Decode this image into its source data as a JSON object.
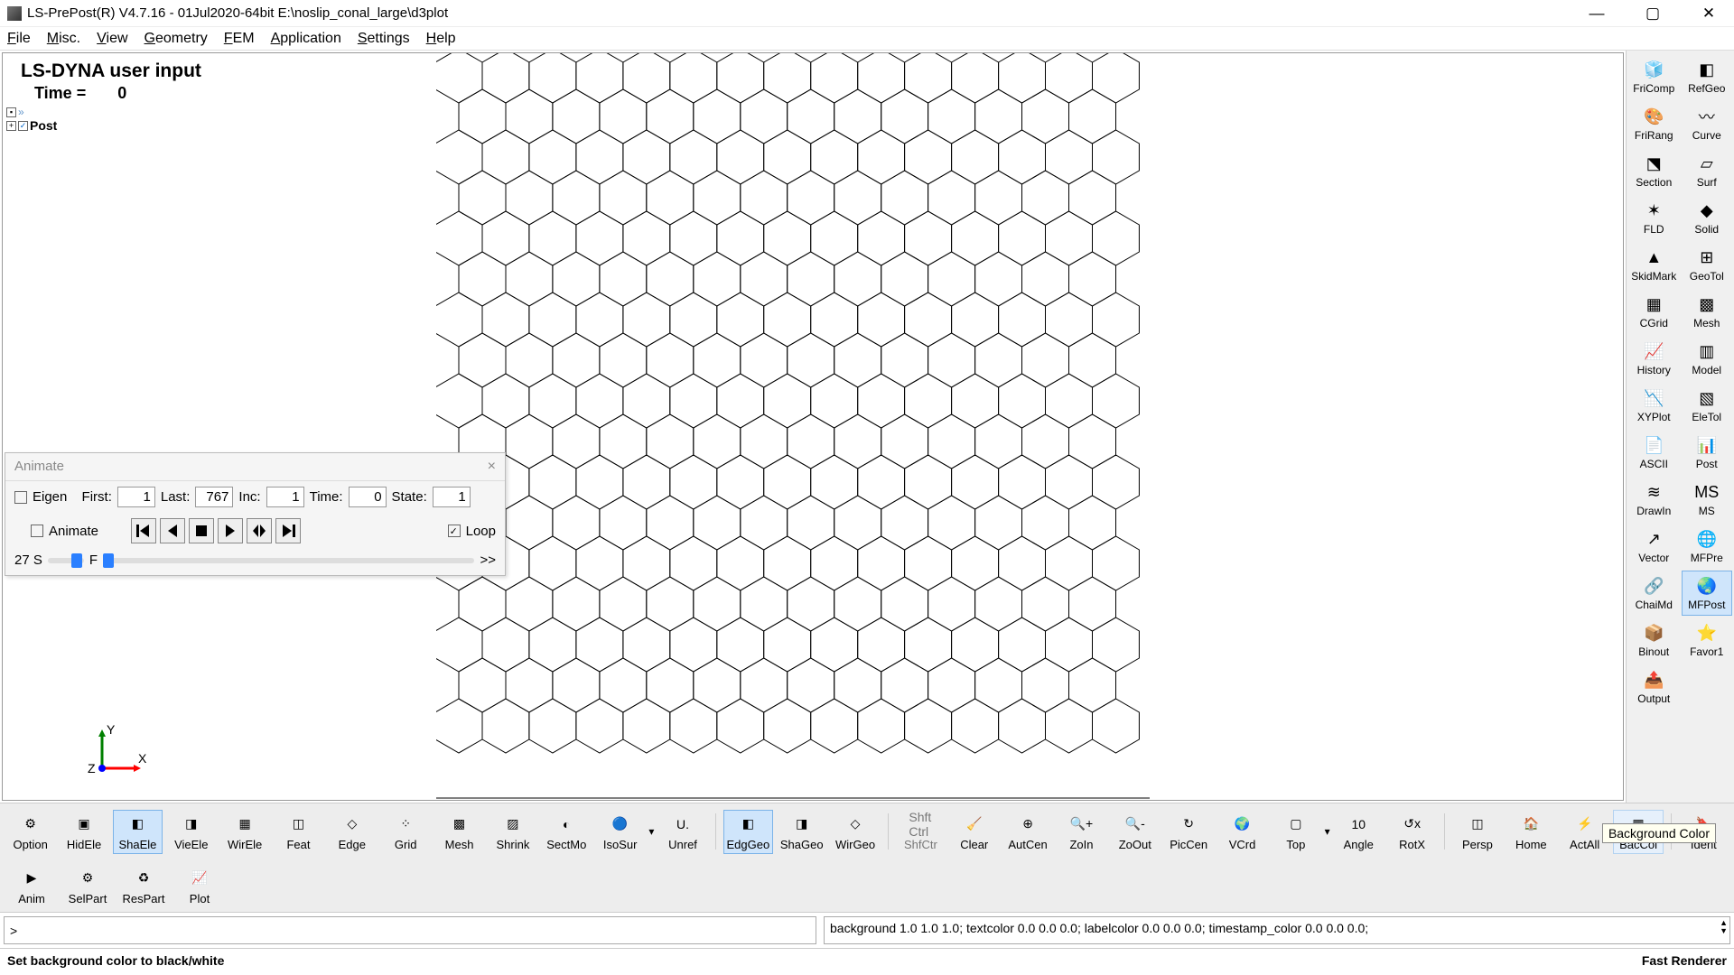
{
  "titlebar": {
    "title": "LS-PrePost(R) V4.7.16 - 01Jul2020-64bit E:\\noslip_conal_large\\d3plot"
  },
  "menu": [
    "File",
    "Misc.",
    "View",
    "Geometry",
    "FEM",
    "Application",
    "Settings",
    "Help"
  ],
  "viewport": {
    "heading": "LS-DYNA user input",
    "time_label": "Time =",
    "time_value": "0",
    "tree_root": "Post"
  },
  "animate": {
    "title": "Animate",
    "eigen": "Eigen",
    "first_label": "First:",
    "first": "1",
    "last_label": "Last:",
    "last": "767",
    "inc_label": "Inc:",
    "inc": "1",
    "time_label": "Time:",
    "time_value": "0",
    "state_label": "State:",
    "state": "1",
    "animate_label": "Animate",
    "loop_label": "Loop",
    "speed_left": "27 S",
    "speed_f": "F",
    "speed_more": ">>"
  },
  "right_tools": [
    {
      "label": "FriComp",
      "icon": "🧊"
    },
    {
      "label": "RefGeo",
      "icon": "◧"
    },
    {
      "label": "FriRang",
      "icon": "🎨"
    },
    {
      "label": "Curve",
      "icon": "〰"
    },
    {
      "label": "Section",
      "icon": "⬔"
    },
    {
      "label": "Surf",
      "icon": "▱"
    },
    {
      "label": "FLD",
      "icon": "✶"
    },
    {
      "label": "Solid",
      "icon": "◆"
    },
    {
      "label": "SkidMark",
      "icon": "▲"
    },
    {
      "label": "GeoTol",
      "icon": "⊞"
    },
    {
      "label": "CGrid",
      "icon": "▦"
    },
    {
      "label": "Mesh",
      "icon": "▩"
    },
    {
      "label": "History",
      "icon": "📈"
    },
    {
      "label": "Model",
      "icon": "▥"
    },
    {
      "label": "XYPlot",
      "icon": "📉"
    },
    {
      "label": "EleTol",
      "icon": "▧"
    },
    {
      "label": "ASCII",
      "icon": "📄"
    },
    {
      "label": "Post",
      "icon": "📊"
    },
    {
      "label": "DrawIn",
      "icon": "≋"
    },
    {
      "label": "MS",
      "icon": "MS"
    },
    {
      "label": "Vector",
      "icon": "↗"
    },
    {
      "label": "MFPre",
      "icon": "🌐"
    },
    {
      "label": "ChaiMd",
      "icon": "🔗"
    },
    {
      "label": "MFPost",
      "icon": "🌏",
      "active": true
    },
    {
      "label": "Binout",
      "icon": "📦"
    },
    {
      "label": "Favor1",
      "icon": "⭐"
    },
    {
      "label": "Output",
      "icon": "📤"
    }
  ],
  "bottom_row1": [
    {
      "label": "Option",
      "icon": "⚙"
    },
    {
      "label": "HidEle",
      "icon": "▣"
    },
    {
      "label": "ShaEle",
      "icon": "◧",
      "active": true
    },
    {
      "label": "VieEle",
      "icon": "◨"
    },
    {
      "label": "WirEle",
      "icon": "▦"
    },
    {
      "label": "Feat",
      "icon": "◫"
    },
    {
      "label": "Edge",
      "icon": "◇"
    },
    {
      "label": "Grid",
      "icon": "⁘"
    },
    {
      "label": "Mesh",
      "icon": "▩"
    },
    {
      "label": "Shrink",
      "icon": "▨"
    },
    {
      "label": "SectMo",
      "icon": "◐"
    },
    {
      "label": "IsoSur",
      "icon": "🔵"
    },
    {
      "caret": true
    },
    {
      "label": "Unref",
      "icon": "U."
    },
    {
      "sep": true
    },
    {
      "label": "EdgGeo",
      "icon": "◧",
      "active": true
    },
    {
      "label": "ShaGeo",
      "icon": "◨"
    },
    {
      "label": "WirGeo",
      "icon": "◇"
    },
    {
      "sep": true
    },
    {
      "label": "ShfCtr",
      "icon": "Shft Ctrl",
      "disabled": true
    },
    {
      "label": "Clear",
      "icon": "🧹"
    },
    {
      "label": "AutCen",
      "icon": "⊕"
    },
    {
      "label": "ZoIn",
      "icon": "🔍+"
    },
    {
      "label": "ZoOut",
      "icon": "🔍-"
    },
    {
      "label": "PicCen",
      "icon": "↻"
    },
    {
      "label": "VCrd",
      "icon": "🌍"
    },
    {
      "label": "Top",
      "icon": "▢"
    },
    {
      "caret": true
    },
    {
      "label": "Angle",
      "icon": "10"
    },
    {
      "label": "RotX",
      "icon": "↺x"
    },
    {
      "sep": true
    },
    {
      "label": "Persp",
      "icon": "◫"
    },
    {
      "label": "Home",
      "icon": "🏠"
    },
    {
      "label": "ActAll",
      "icon": "⚡"
    },
    {
      "label": "BacCol",
      "icon": "▦",
      "hover": true
    },
    {
      "sep": true
    },
    {
      "label": "Ident",
      "icon": "🔖"
    }
  ],
  "bottom_row2": [
    {
      "label": "Anim",
      "icon": "▶"
    },
    {
      "label": "SelPart",
      "icon": "⚙"
    },
    {
      "label": "ResPart",
      "icon": "♻"
    },
    {
      "label": "Plot",
      "icon": "📈"
    }
  ],
  "tooltip": "Background Color",
  "cmd_prompt": ">",
  "log_text": "background 1.0 1.0 1.0; textcolor 0.0 0.0 0.0; labelcolor 0.0 0.0 0.0; timestamp_color 0.0 0.0 0.0;",
  "status_left": "Set background color to black/white",
  "status_right": "Fast Renderer"
}
